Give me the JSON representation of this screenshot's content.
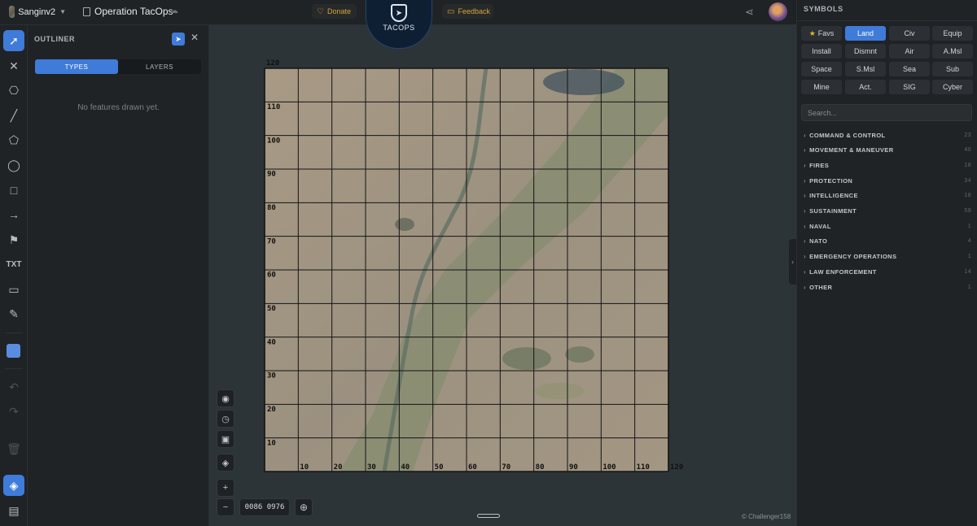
{
  "header": {
    "map_name": "Sanginv2",
    "operation_title": "Operation TacOps",
    "donate_label": "Donate",
    "feedback_label": "Feedback",
    "logo_text": "TACOPS"
  },
  "toolbar": {
    "text_tool_label": "TXT",
    "active_color": "#5a8de0",
    "accent_color": "#3f7bd9"
  },
  "outliner": {
    "title": "OUTLINER",
    "tabs": [
      "TYPES",
      "LAYERS"
    ],
    "active_tab": "TYPES",
    "empty_message": "No features drawn yet."
  },
  "map": {
    "grid_min": 0,
    "grid_max": 120,
    "grid_step": 10,
    "y_labels": [
      "120",
      "110",
      "100",
      "90",
      "80",
      "70",
      "60",
      "50",
      "40",
      "30",
      "20",
      "10"
    ],
    "x_labels": [
      "10",
      "20",
      "30",
      "40",
      "50",
      "60",
      "70",
      "80",
      "90",
      "100",
      "110",
      "120"
    ],
    "coordinates": "0086 0976",
    "credit": "© Challenger158"
  },
  "symbols": {
    "title": "SYMBOLS",
    "categories": [
      [
        "Favs",
        "Land",
        "Civ",
        "Equip"
      ],
      [
        "Install",
        "Dismnt",
        "Air",
        "A.Msl"
      ],
      [
        "Space",
        "S.Msl",
        "Sea",
        "Sub"
      ],
      [
        "Mine",
        "Act.",
        "SIG",
        "Cyber"
      ]
    ],
    "active_category": "Land",
    "search_placeholder": "Search...",
    "groups": [
      {
        "label": "COMMAND & CONTROL",
        "count": "23"
      },
      {
        "label": "MOVEMENT & MANEUVER",
        "count": "40"
      },
      {
        "label": "FIRES",
        "count": "18"
      },
      {
        "label": "PROTECTION",
        "count": "34"
      },
      {
        "label": "INTELLIGENCE",
        "count": "18"
      },
      {
        "label": "SUSTAINMENT",
        "count": "59"
      },
      {
        "label": "NAVAL",
        "count": "1"
      },
      {
        "label": "NATO",
        "count": "4"
      },
      {
        "label": "EMERGENCY OPERATIONS",
        "count": "1"
      },
      {
        "label": "LAW ENFORCEMENT",
        "count": "14"
      },
      {
        "label": "OTHER",
        "count": "1"
      }
    ]
  }
}
